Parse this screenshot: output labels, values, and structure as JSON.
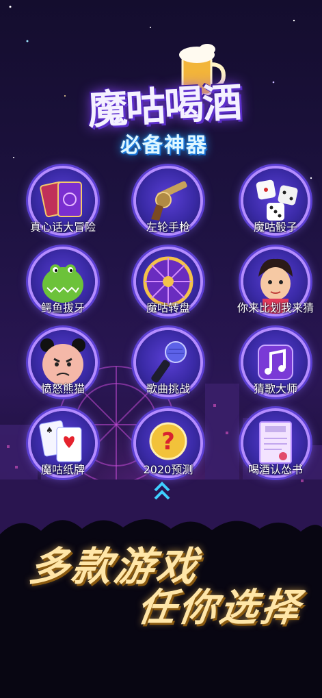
{
  "header": {
    "title": "魔咕喝酒",
    "subtitle": "必备神器"
  },
  "games": [
    {
      "label": "真心话大冒险",
      "icon": "tarot-cards-icon"
    },
    {
      "label": "左轮手枪",
      "icon": "revolver-icon"
    },
    {
      "label": "魔咕骰子",
      "icon": "dice-icon"
    },
    {
      "label": "鳄鱼拔牙",
      "icon": "crocodile-icon"
    },
    {
      "label": "魔咕转盘",
      "icon": "wheel-icon"
    },
    {
      "label": "你来比划我来猜",
      "icon": "cartoon-face-icon"
    },
    {
      "label": "愤怒熊猫",
      "icon": "panda-face-icon"
    },
    {
      "label": "歌曲挑战",
      "icon": "microphone-icon"
    },
    {
      "label": "猜歌大师",
      "icon": "music-note-icon"
    },
    {
      "label": "魔咕纸牌",
      "icon": "playing-cards-icon"
    },
    {
      "label": "2020预测",
      "icon": "question-mark-icon"
    },
    {
      "label": "喝酒认怂书",
      "icon": "certificate-icon"
    }
  ],
  "slogan": {
    "line1": "多款游戏",
    "line2": "任你选择"
  },
  "colors": {
    "accent": "#b48cff",
    "title_glow": "#8f4bff",
    "slogan": "#ffe6a8",
    "arrow": "#3fd0ff"
  }
}
